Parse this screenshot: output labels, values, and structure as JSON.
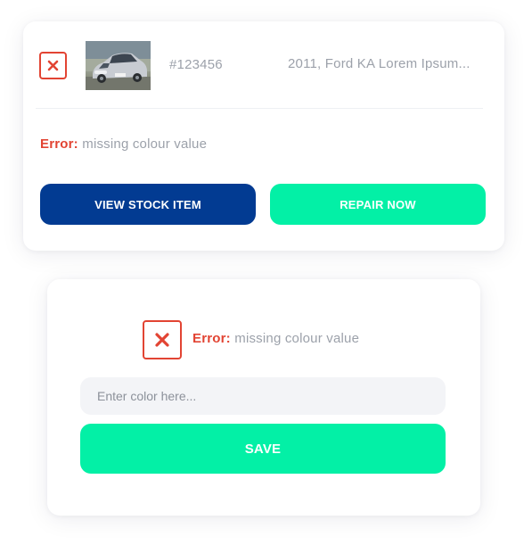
{
  "colors": {
    "error": "#e24433",
    "primary": "#023b92",
    "accent": "#03f0a6",
    "muted_text": "#9ca1aa",
    "input_bg": "#f3f4f7"
  },
  "stock_card": {
    "status_icon": "close-icon",
    "thumbnail": "car-photo",
    "stock_id": "#123456",
    "title": "2011, Ford KA Lorem Ipsum...",
    "error_label": "Error:",
    "error_message": "missing colour value",
    "view_button_label": "VIEW STOCK ITEM",
    "repair_button_label": "REPAIR NOW"
  },
  "repair_card": {
    "status_icon": "close-icon",
    "error_label": "Error:",
    "error_message": "missing colour value",
    "color_input": {
      "placeholder": "Enter color here...",
      "value": ""
    },
    "save_button_label": "SAVE"
  }
}
